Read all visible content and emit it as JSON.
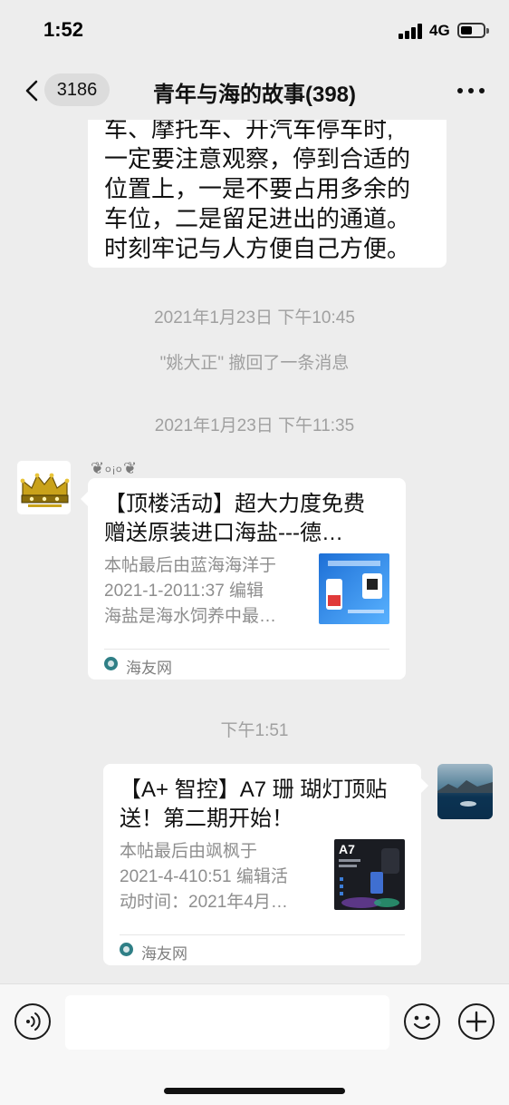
{
  "status_bar": {
    "time": "1:52",
    "network": "4G"
  },
  "nav": {
    "unread_count": "3186",
    "title": "青年与海的故事(398)"
  },
  "messages": {
    "text_lines": [
      "车、摩托车、开汽车停车时,",
      "一定要注意观察，停到合适的",
      "位置上，一是不要占用多余的",
      "车位，二是留足进出的通道。",
      "时刻牢记与人方便自己方便。"
    ],
    "timestamp_1": "2021年1月23日 下午10:45",
    "recall_notice": "\"姚大正\" 撤回了一条消息",
    "timestamp_2": "2021年1月23日 下午11:35",
    "sender_nickname": "❦৹ᵢ৹❦",
    "card_1": {
      "title_line_1": "【顶楼活动】超大力度免费",
      "title_line_2": "赠送原装进口海盐---德…",
      "desc_line_1": "本帖最后由蓝海海洋于",
      "desc_line_2": "2021-1-2011:37 编辑",
      "desc_line_3": "海盐是海水饲养中最…",
      "source": "海友网"
    },
    "timestamp_3": "下午1:51",
    "card_2": {
      "title_line_1": "【A+ 智控】A7 珊 瑚灯顶贴",
      "title_line_2": "送！第二期开始！",
      "desc_line_1": "本帖最后由飒枫于",
      "desc_line_2": "2021-4-410:51 编辑活",
      "desc_line_3": "动时间：2021年4月…",
      "thumb_label": "A7",
      "source": "海友网"
    }
  },
  "input_bar": {
    "placeholder": ""
  },
  "colors": {
    "background": "#ededed",
    "bubble": "#ffffff",
    "system_text": "#a0a0a0",
    "source_icon": "#2f7f86"
  },
  "icons": {
    "voice": "voice-icon",
    "emoji": "emoji-icon",
    "plus": "plus-icon",
    "back": "back-chevron-icon",
    "more": "more-dots-icon"
  }
}
